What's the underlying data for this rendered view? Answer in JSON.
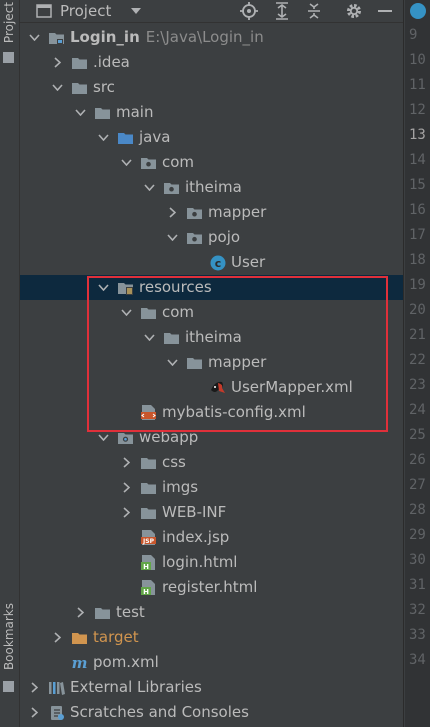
{
  "side_tabs": {
    "project": "Project",
    "bookmarks": "Bookmarks"
  },
  "toolbar": {
    "title": "Project"
  },
  "tree": [
    {
      "depth": 0,
      "expanded": true,
      "icon": "module-folder-icon",
      "label": "Login_in",
      "path": "E:\\Java\\Login_in",
      "bold": true
    },
    {
      "depth": 1,
      "expanded": false,
      "icon": "folder-icon",
      "label": ".idea"
    },
    {
      "depth": 1,
      "expanded": true,
      "icon": "folder-icon",
      "label": "src"
    },
    {
      "depth": 2,
      "expanded": true,
      "icon": "folder-icon",
      "label": "main"
    },
    {
      "depth": 3,
      "expanded": true,
      "icon": "source-root-folder-icon",
      "label": "java"
    },
    {
      "depth": 4,
      "expanded": true,
      "icon": "package-icon",
      "label": "com"
    },
    {
      "depth": 5,
      "expanded": true,
      "icon": "package-icon",
      "label": "itheima"
    },
    {
      "depth": 6,
      "expanded": false,
      "icon": "package-icon",
      "label": "mapper"
    },
    {
      "depth": 6,
      "expanded": true,
      "icon": "package-icon",
      "label": "pojo"
    },
    {
      "depth": 7,
      "expanded": null,
      "icon": "java-class-icon",
      "label": "User"
    },
    {
      "depth": 3,
      "expanded": true,
      "icon": "resources-root-folder-icon",
      "label": "resources",
      "selected": true
    },
    {
      "depth": 4,
      "expanded": true,
      "icon": "folder-icon",
      "label": "com"
    },
    {
      "depth": 5,
      "expanded": true,
      "icon": "folder-icon",
      "label": "itheima"
    },
    {
      "depth": 6,
      "expanded": true,
      "icon": "folder-icon",
      "label": "mapper"
    },
    {
      "depth": 7,
      "expanded": null,
      "icon": "mybatis-mapper-icon",
      "label": "UserMapper.xml"
    },
    {
      "depth": 4,
      "expanded": null,
      "icon": "xml-file-icon",
      "label": "mybatis-config.xml"
    },
    {
      "depth": 3,
      "expanded": true,
      "icon": "web-folder-icon",
      "label": "webapp"
    },
    {
      "depth": 4,
      "expanded": false,
      "icon": "folder-icon",
      "label": "css"
    },
    {
      "depth": 4,
      "expanded": false,
      "icon": "folder-icon",
      "label": "imgs"
    },
    {
      "depth": 4,
      "expanded": false,
      "icon": "folder-icon",
      "label": "WEB-INF"
    },
    {
      "depth": 4,
      "expanded": null,
      "icon": "jsp-file-icon",
      "label": "index.jsp"
    },
    {
      "depth": 4,
      "expanded": null,
      "icon": "html-file-icon",
      "label": "login.html"
    },
    {
      "depth": 4,
      "expanded": null,
      "icon": "html-file-icon",
      "label": "register.html"
    },
    {
      "depth": 2,
      "expanded": false,
      "icon": "folder-icon",
      "label": "test"
    },
    {
      "depth": 1,
      "expanded": false,
      "icon": "excluded-folder-icon",
      "label": "target",
      "orange": true
    },
    {
      "depth": 1,
      "expanded": null,
      "icon": "maven-icon",
      "label": "pom.xml"
    },
    {
      "depth": 0,
      "expanded": false,
      "icon": "libraries-icon",
      "label": "External Libraries"
    },
    {
      "depth": 0,
      "expanded": false,
      "icon": "scratches-icon",
      "label": "Scratches and Consoles"
    }
  ],
  "gutter": {
    "line_numbers": [
      "9",
      "10",
      "11",
      "12",
      "13",
      "14",
      "15",
      "16",
      "17",
      "18",
      "19",
      "20",
      "21",
      "22",
      "23",
      "24",
      "25",
      "26",
      "27",
      "28",
      "29",
      "30",
      "31",
      "32",
      "33",
      "34"
    ],
    "current_line": "13"
  },
  "colors": {
    "selection": "#0d293e",
    "highlight_box": "#e0303a",
    "folder": "#87939a",
    "source_root": "#4a88c7",
    "excluded": "#d1954f"
  }
}
